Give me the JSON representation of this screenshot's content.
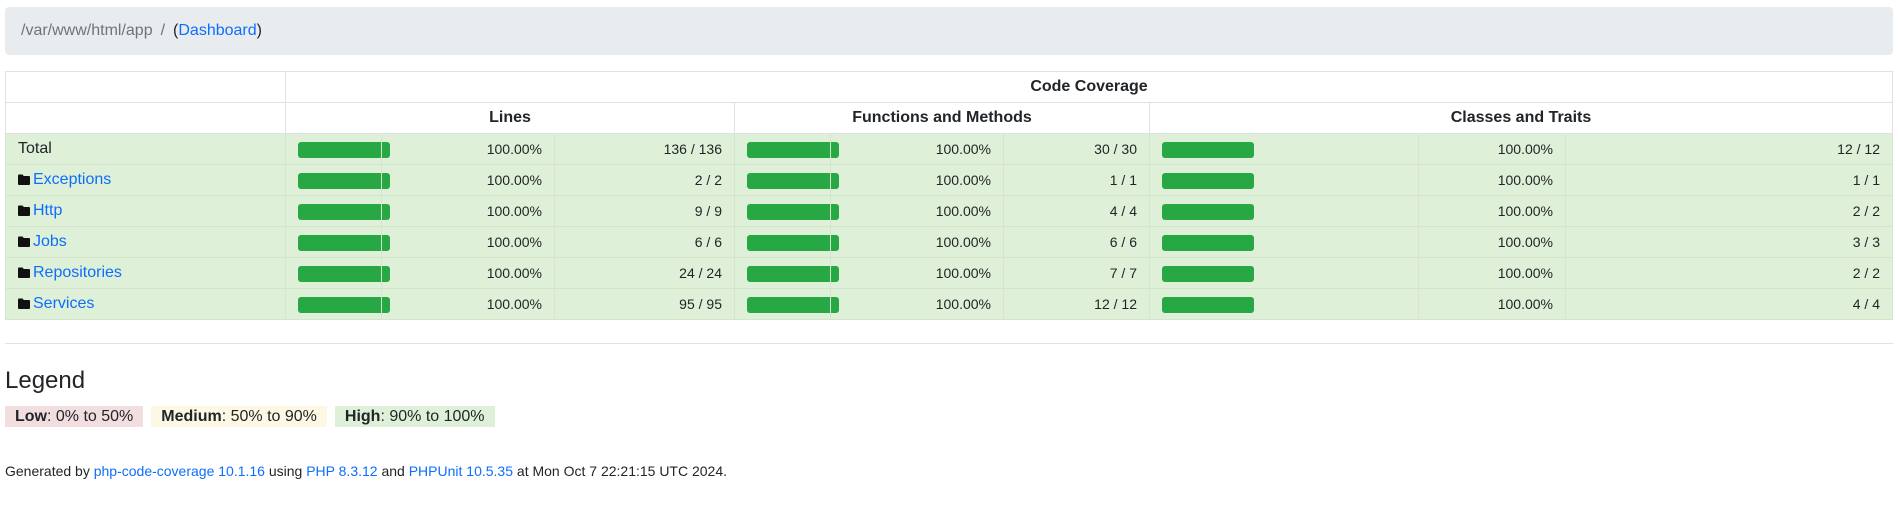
{
  "breadcrumb": {
    "path": "/var/www/html/app",
    "separator": "/",
    "open_paren": "(",
    "dashboard_link": "Dashboard",
    "close_paren": ")"
  },
  "table": {
    "group_header": "Code Coverage",
    "column_headers": [
      "Lines",
      "Functions and Methods",
      "Classes and Traits"
    ],
    "rows": [
      {
        "name": "Total",
        "is_folder": false,
        "lines": {
          "pct": "100.00%",
          "count": "136 / 136",
          "coverage": 1.0
        },
        "functions": {
          "pct": "100.00%",
          "count": "30 / 30",
          "coverage": 1.0
        },
        "classes": {
          "pct": "100.00%",
          "count": "12 / 12",
          "coverage": 1.0
        }
      },
      {
        "name": "Exceptions",
        "is_folder": true,
        "lines": {
          "pct": "100.00%",
          "count": "2 / 2",
          "coverage": 1.0
        },
        "functions": {
          "pct": "100.00%",
          "count": "1 / 1",
          "coverage": 1.0
        },
        "classes": {
          "pct": "100.00%",
          "count": "1 / 1",
          "coverage": 1.0
        }
      },
      {
        "name": "Http",
        "is_folder": true,
        "lines": {
          "pct": "100.00%",
          "count": "9 / 9",
          "coverage": 1.0
        },
        "functions": {
          "pct": "100.00%",
          "count": "4 / 4",
          "coverage": 1.0
        },
        "classes": {
          "pct": "100.00%",
          "count": "2 / 2",
          "coverage": 1.0
        }
      },
      {
        "name": "Jobs",
        "is_folder": true,
        "lines": {
          "pct": "100.00%",
          "count": "6 / 6",
          "coverage": 1.0
        },
        "functions": {
          "pct": "100.00%",
          "count": "6 / 6",
          "coverage": 1.0
        },
        "classes": {
          "pct": "100.00%",
          "count": "3 / 3",
          "coverage": 1.0
        }
      },
      {
        "name": "Repositories",
        "is_folder": true,
        "lines": {
          "pct": "100.00%",
          "count": "24 / 24",
          "coverage": 1.0
        },
        "functions": {
          "pct": "100.00%",
          "count": "7 / 7",
          "coverage": 1.0
        },
        "classes": {
          "pct": "100.00%",
          "count": "2 / 2",
          "coverage": 1.0
        }
      },
      {
        "name": "Services",
        "is_folder": true,
        "lines": {
          "pct": "100.00%",
          "count": "95 / 95",
          "coverage": 1.0
        },
        "functions": {
          "pct": "100.00%",
          "count": "12 / 12",
          "coverage": 1.0
        },
        "classes": {
          "pct": "100.00%",
          "count": "4 / 4",
          "coverage": 1.0
        }
      }
    ]
  },
  "legend": {
    "title": "Legend",
    "low_label": "Low",
    "low_range": ": 0% to 50%",
    "medium_label": "Medium",
    "medium_range": ": 50% to 90%",
    "high_label": "High",
    "high_range": ": 90% to 100%"
  },
  "footer": {
    "generated_by": "Generated by",
    "tool_link": "php-code-coverage 10.1.16",
    "using": "using",
    "php_link": "PHP 8.3.12",
    "and": "and",
    "phpunit_link": "PHPUnit 10.5.35",
    "timestamp": "at Mon Oct 7 22:21:15 UTC 2024."
  },
  "colors": {
    "bar_success": "#28a745",
    "row_high": "#dff0d8",
    "legend_low": "#f2dede",
    "legend_medium": "#fcf8e3",
    "link": "#0d6efd",
    "breadcrumb_bg": "#e9ecef"
  },
  "icons": {
    "folder": "folder-icon"
  }
}
